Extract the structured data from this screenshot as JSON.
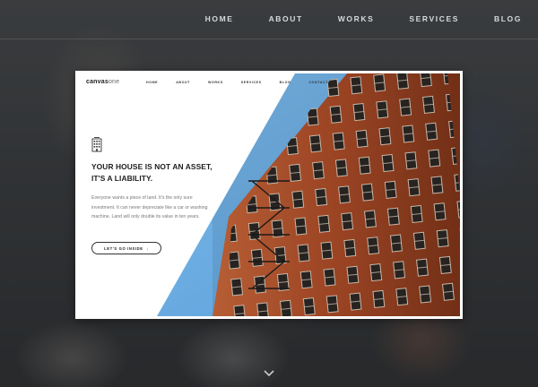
{
  "nav": {
    "items": [
      "HOME",
      "ABOUT",
      "WORKS",
      "SERVICES",
      "BLOG"
    ]
  },
  "preview": {
    "logo_bold": "canvas",
    "logo_light": "one",
    "menu": [
      "HOME",
      "ABOUT",
      "WORKS",
      "SERVICES",
      "BLOG",
      "CONTACT"
    ],
    "headline_line1": "YOUR HOUSE IS NOT AN ASSET,",
    "headline_line2": "IT'S A LIABILITY.",
    "body": "Everyone wants a piece of land. It's the only sure investment. It can never depreciate like a car or washing machine. Land will only double its value in ten years.",
    "button_label": "LET'S GO INSIDE",
    "button_arrow": "↓"
  },
  "colors": {
    "accent_blue": "#6aaee6",
    "brick": "#b5552e"
  },
  "icons": {
    "building": "building-icon",
    "scroll": "chevron-down-icon"
  }
}
